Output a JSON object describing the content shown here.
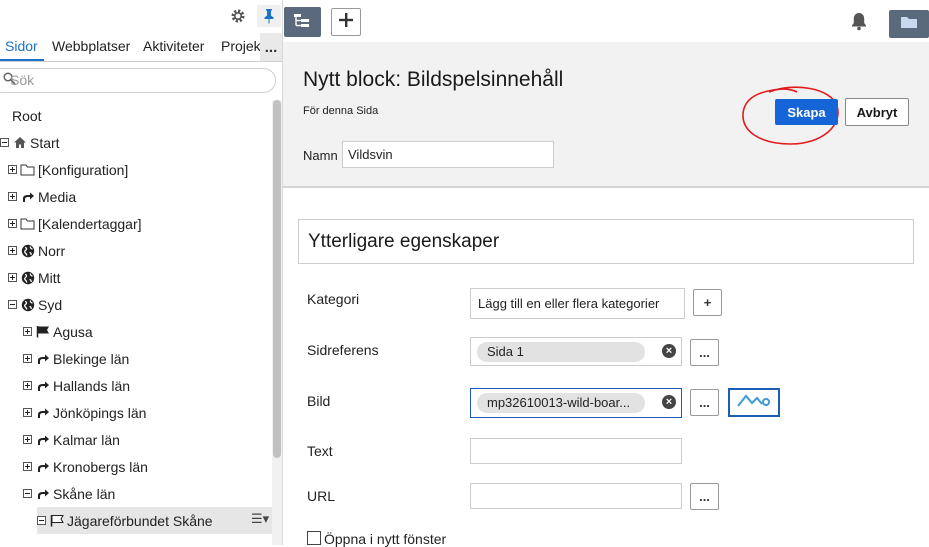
{
  "left": {
    "tabs": [
      "Sidor",
      "Webbplatser",
      "Aktiviteter",
      "Projekt"
    ],
    "more_label": "...",
    "search_placeholder": "Sök",
    "tree": [
      {
        "label": "Root",
        "icon": "none",
        "expander": "none"
      },
      {
        "label": "Start",
        "icon": "home",
        "expander": "minus"
      },
      {
        "label": "[Konfiguration]",
        "icon": "folder",
        "expander": "plus"
      },
      {
        "label": "Media",
        "icon": "arrow",
        "expander": "plus"
      },
      {
        "label": "[Kalendertaggar]",
        "icon": "folder",
        "expander": "plus"
      },
      {
        "label": "Norr",
        "icon": "globe",
        "expander": "plus"
      },
      {
        "label": "Mitt",
        "icon": "globe",
        "expander": "plus"
      },
      {
        "label": "Syd",
        "icon": "globe",
        "expander": "minus"
      },
      {
        "label": "Agusa",
        "icon": "flag",
        "expander": "plus"
      },
      {
        "label": "Blekinge län",
        "icon": "arrow",
        "expander": "plus"
      },
      {
        "label": "Hallands län",
        "icon": "arrow",
        "expander": "plus"
      },
      {
        "label": "Jönköpings län",
        "icon": "arrow",
        "expander": "plus"
      },
      {
        "label": "Kalmar län",
        "icon": "arrow",
        "expander": "plus"
      },
      {
        "label": "Kronobergs län",
        "icon": "arrow",
        "expander": "plus"
      },
      {
        "label": "Skåne län",
        "icon": "arrow",
        "expander": "minus"
      },
      {
        "label": "Jägareförbundet Skåne",
        "icon": "flag-outline",
        "expander": "minus"
      }
    ]
  },
  "header": {
    "title": "Nytt block: Bildspelsinnehåll",
    "subtitle": "För denna Sida",
    "create_label": "Skapa",
    "cancel_label": "Avbryt",
    "name_label": "Namn",
    "name_value": "Vildsvin"
  },
  "form": {
    "section_title": "Ytterligare egenskaper",
    "category_label": "Kategori",
    "category_value": "Lägg till en eller flera kategorier",
    "category_add": "+",
    "pageref_label": "Sidreferens",
    "pageref_value": "Sida 1",
    "image_label": "Bild",
    "image_value": "mp32610013-wild-boar...",
    "text_label": "Text",
    "url_label": "URL",
    "browse_label": "...",
    "newwindow_label": "Öppna i nytt fönster"
  },
  "colors": {
    "accent": "#1565d8",
    "annotation": "#e31b1b"
  }
}
